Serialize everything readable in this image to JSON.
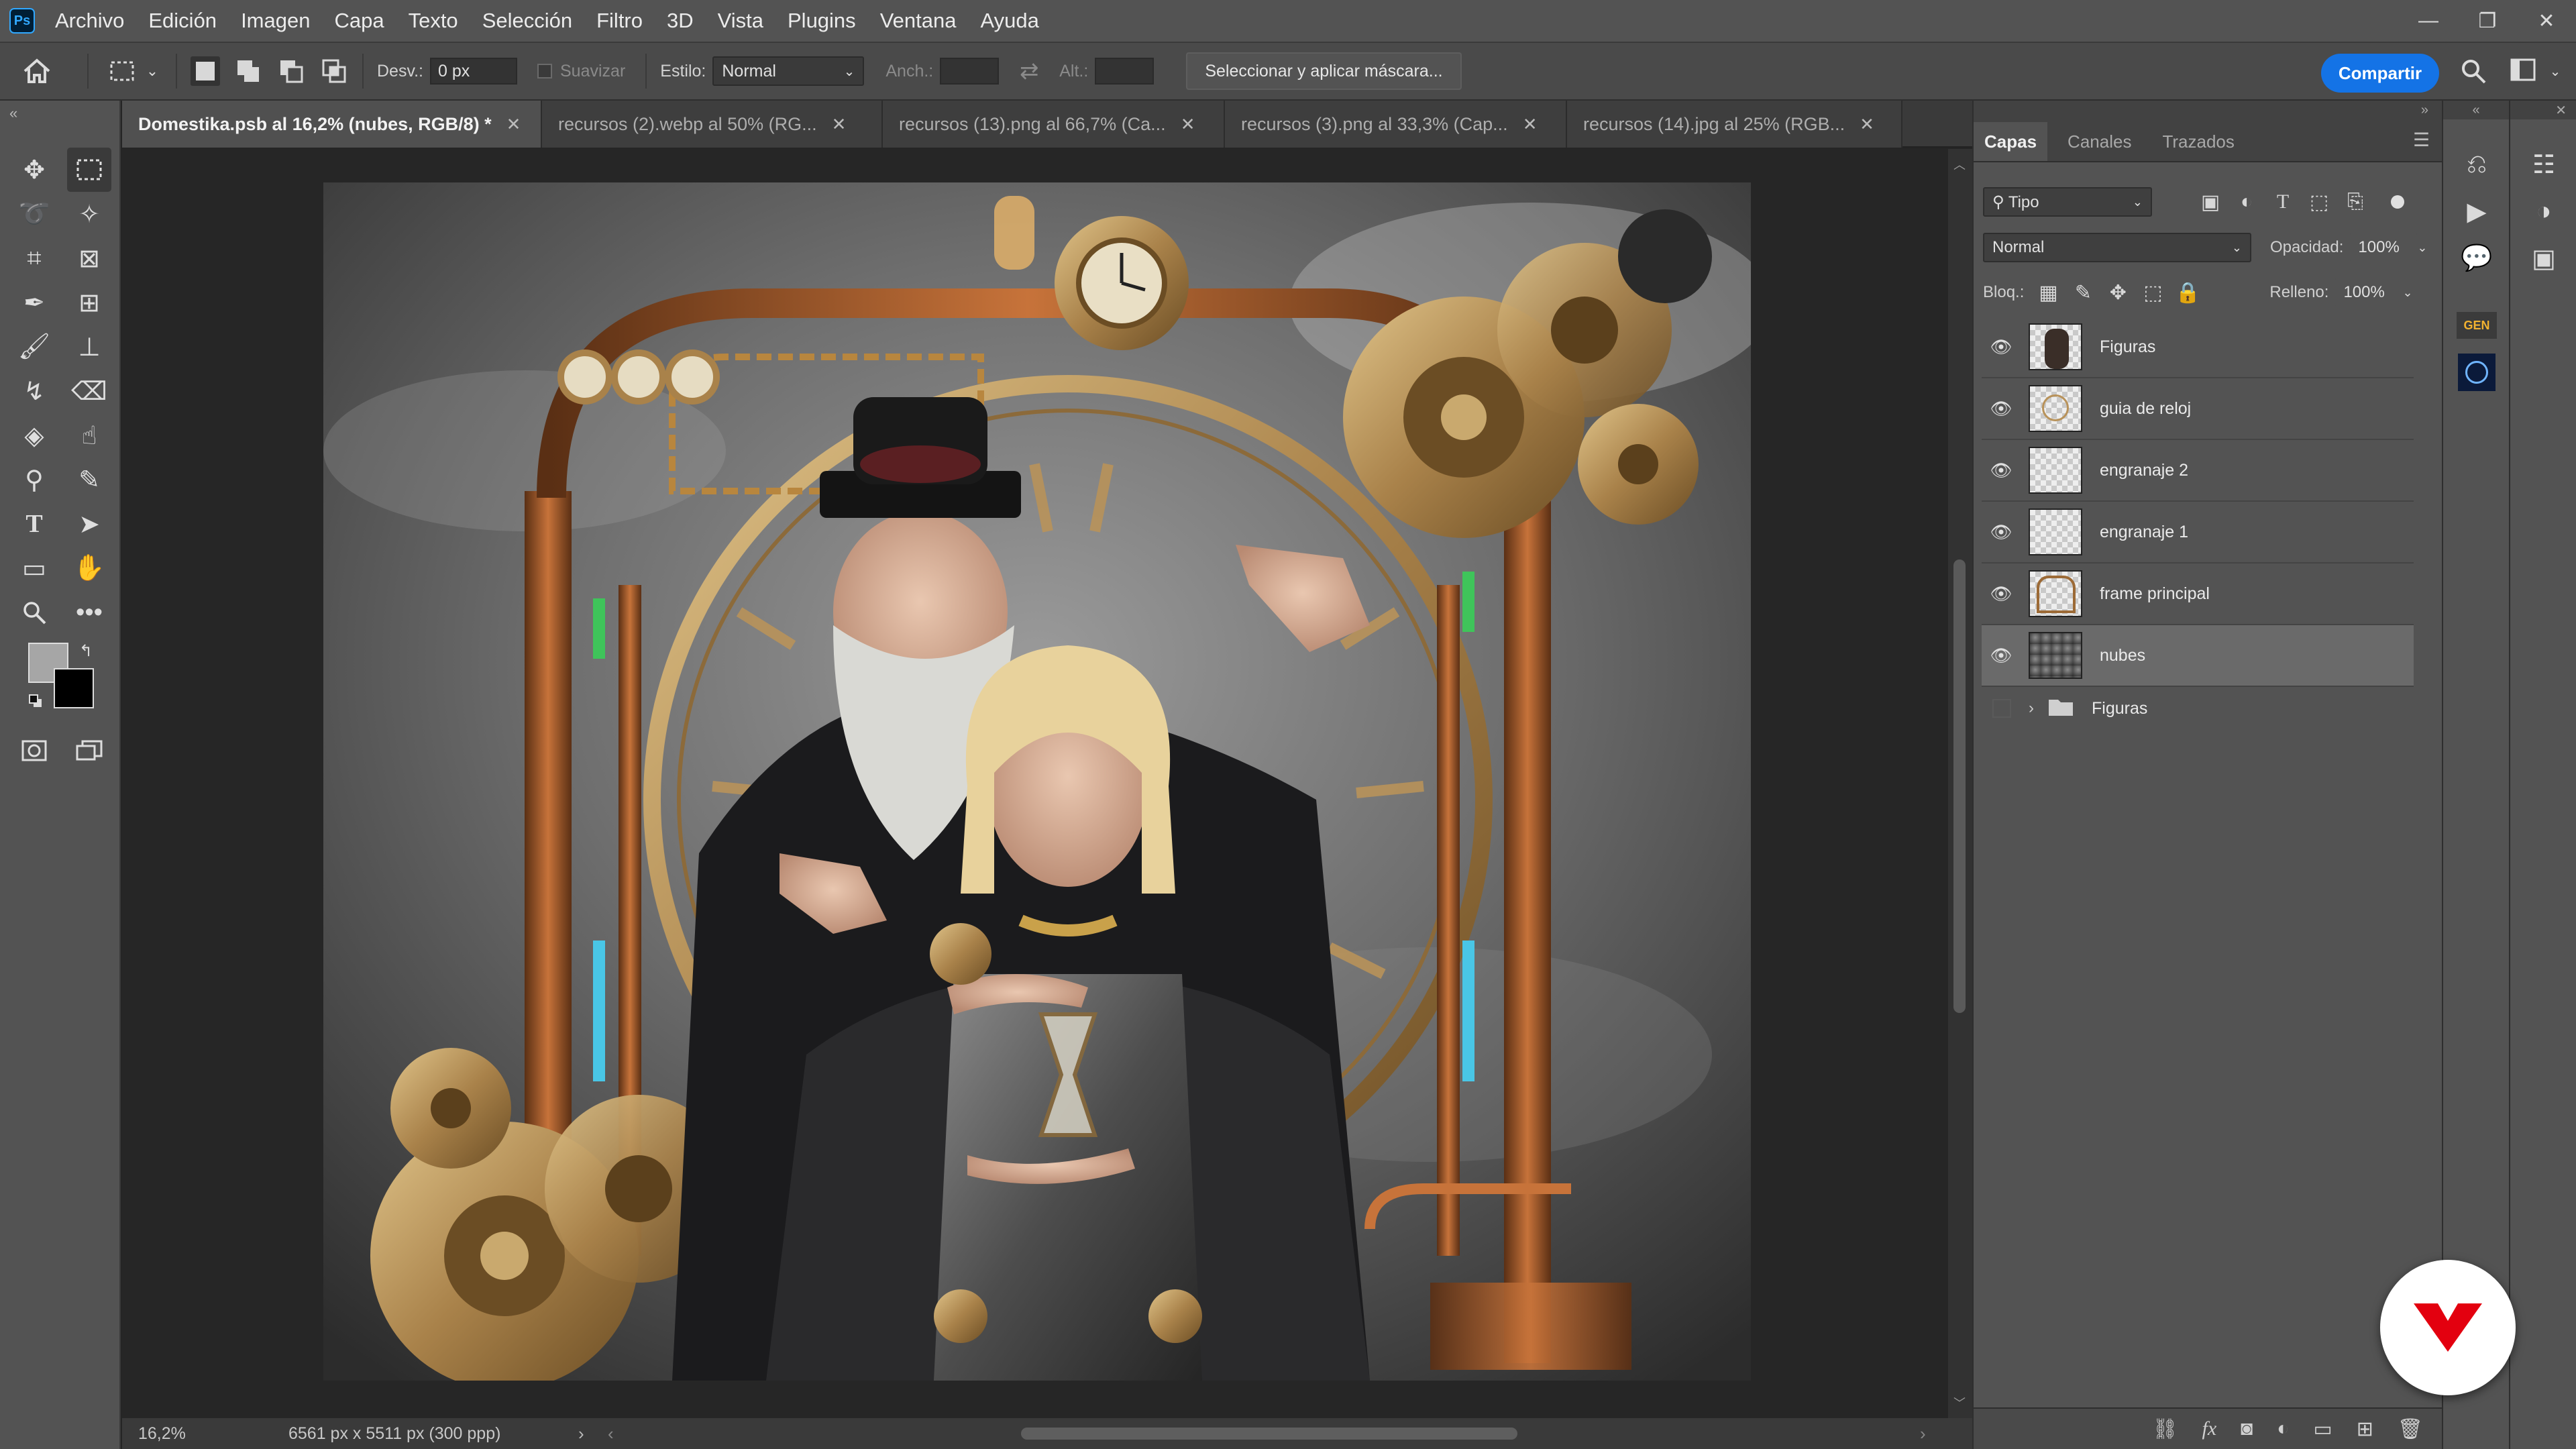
{
  "menubar": {
    "items": [
      "Archivo",
      "Edición",
      "Imagen",
      "Capa",
      "Texto",
      "Selección",
      "Filtro",
      "3D",
      "Vista",
      "Plugins",
      "Ventana",
      "Ayuda"
    ],
    "app_logo": "Ps"
  },
  "options": {
    "desv_label": "Desv.:",
    "desv_value": "0 px",
    "suavizar_label": "Suavizar",
    "estilo_label": "Estilo:",
    "estilo_value": "Normal",
    "anch_label": "Anch.:",
    "alt_label": "Alt.:",
    "mask_button": "Seleccionar y aplicar máscara...",
    "share_button": "Compartir"
  },
  "tabs": [
    {
      "label": "Domestika.psb al 16,2% (nubes, RGB/8) *",
      "active": true
    },
    {
      "label": "recursos (2).webp al 50% (RG...",
      "active": false
    },
    {
      "label": "recursos (13).png al 66,7% (Ca...",
      "active": false
    },
    {
      "label": "recursos (3).png al 33,3% (Cap...",
      "active": false
    },
    {
      "label": "recursos (14).jpg al 25% (RGB...",
      "active": false
    }
  ],
  "status": {
    "zoom": "16,2%",
    "doc_info": "6561 px x 5511 px (300 ppp)"
  },
  "layers_panel": {
    "tabs": [
      "Capas",
      "Canales",
      "Trazados"
    ],
    "filter_value": "Tipo",
    "blend_mode": "Normal",
    "opacity_label": "Opacidad:",
    "opacity_value": "100%",
    "lock_label": "Bloq.:",
    "fill_label": "Relleno:",
    "fill_value": "100%",
    "layers": [
      {
        "name": "Figuras",
        "visible": true,
        "selected": false
      },
      {
        "name": "guia de reloj",
        "visible": true,
        "selected": false
      },
      {
        "name": "engranaje 2",
        "visible": true,
        "selected": false
      },
      {
        "name": "engranaje 1",
        "visible": true,
        "selected": false
      },
      {
        "name": "frame principal",
        "visible": true,
        "selected": false
      },
      {
        "name": "nubes",
        "visible": true,
        "selected": true
      }
    ],
    "group": {
      "name": "Figuras",
      "visible": false
    }
  },
  "colors": {
    "accent": "#1473e6",
    "menubar": "#535353",
    "brand_badge": "#e3000f"
  }
}
